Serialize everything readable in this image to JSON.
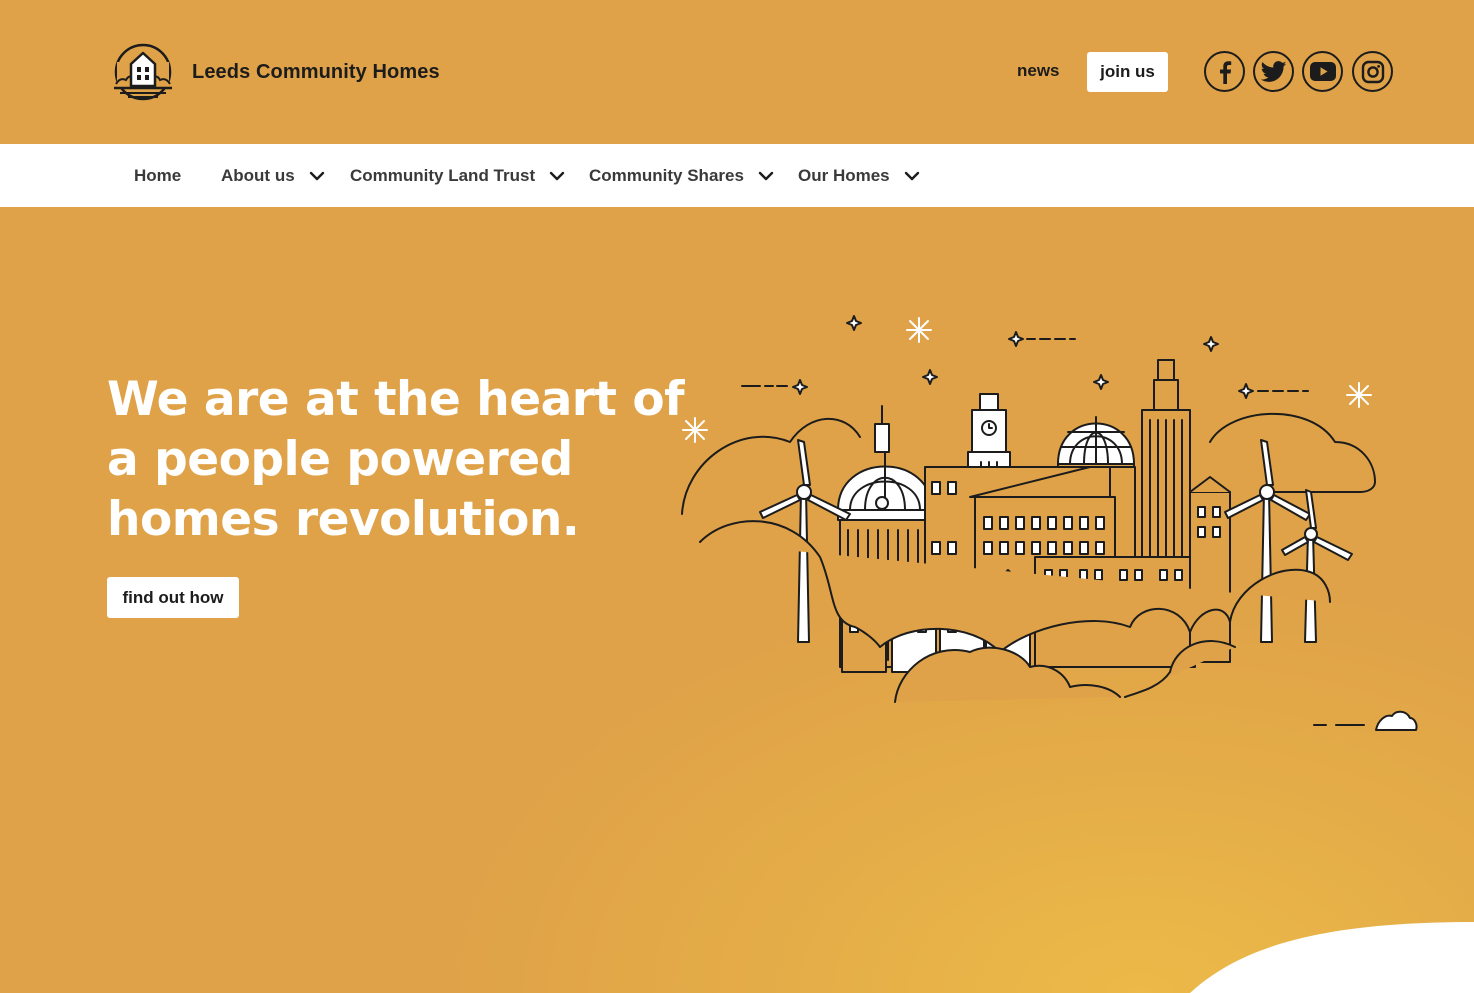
{
  "header": {
    "brand_name": "Leeds Community Homes",
    "news_label": "news",
    "join_label": "join us",
    "social": [
      "facebook-icon",
      "twitter-icon",
      "youtube-icon",
      "instagram-icon"
    ]
  },
  "nav": {
    "items": [
      {
        "label": "Home",
        "has_dropdown": false
      },
      {
        "label": "About us",
        "has_dropdown": true
      },
      {
        "label": "Community Land Trust",
        "has_dropdown": true
      },
      {
        "label": "Community Shares",
        "has_dropdown": true
      },
      {
        "label": "Our Homes",
        "has_dropdown": true
      }
    ]
  },
  "hero": {
    "headline": "We are at the heart of a people powered homes revolution.",
    "cta_label": "find out how"
  },
  "colors": {
    "background": "#dfa248",
    "accent_glow": "#eebe48",
    "text_dark": "#1c1c1c",
    "white": "#ffffff"
  }
}
